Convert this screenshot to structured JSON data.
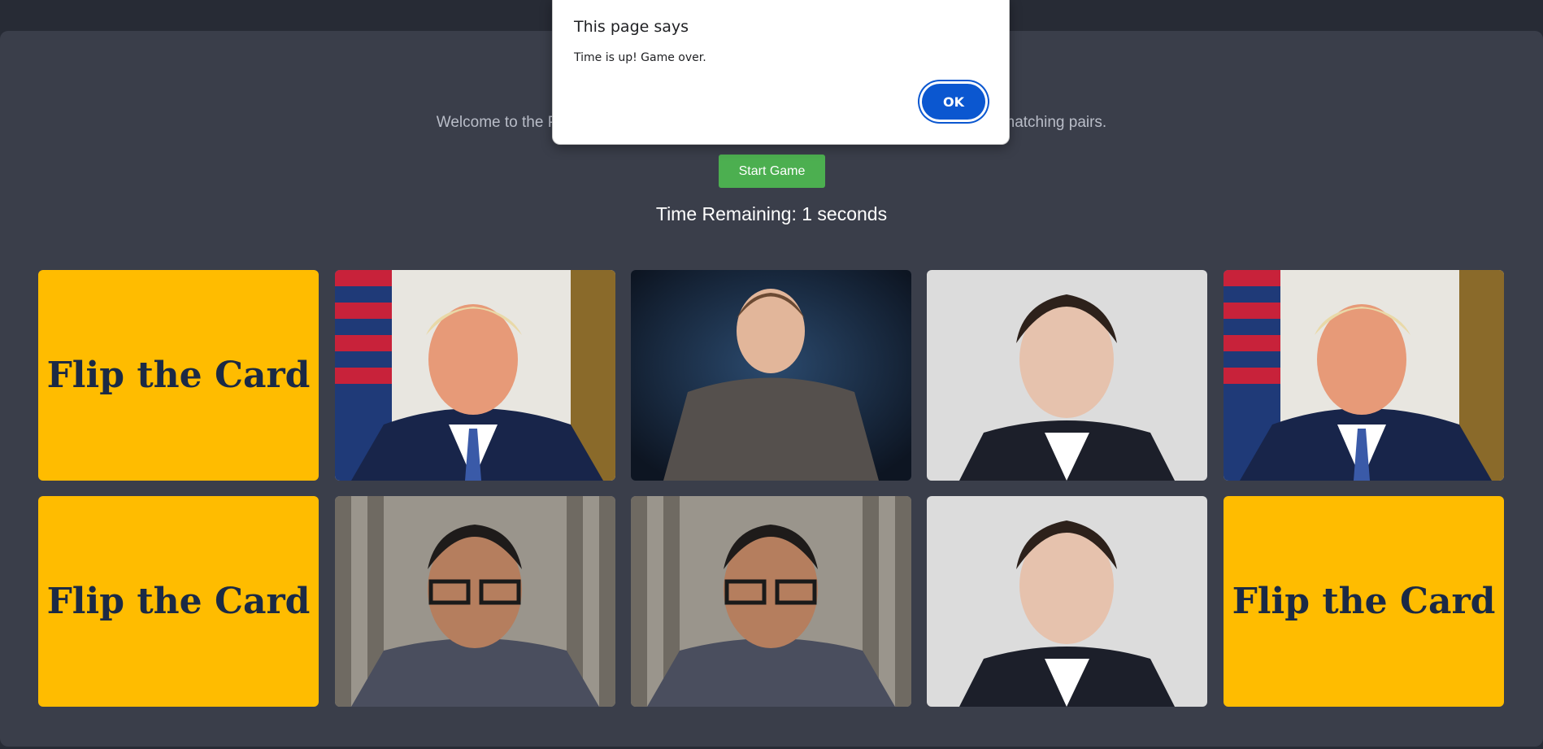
{
  "game": {
    "welcome_text": "Welcome to the Photo Matching Game! Click on the cards to flip them and find the matching pairs.",
    "start_label": "Start Game",
    "timer_text": "Time Remaining: 1 seconds"
  },
  "cards": [
    {
      "state": "back",
      "label": "Flip the Card"
    },
    {
      "state": "face",
      "subject": "man-suit-flag-photo"
    },
    {
      "state": "face",
      "subject": "man-gray-tshirt-photo"
    },
    {
      "state": "face",
      "subject": "man-dark-blazer-photo"
    },
    {
      "state": "face",
      "subject": "man-suit-flag-photo"
    },
    {
      "state": "back",
      "label": "Flip the Card"
    },
    {
      "state": "face",
      "subject": "man-glasses-blazer-photo"
    },
    {
      "state": "face",
      "subject": "man-glasses-blazer-photo"
    },
    {
      "state": "face",
      "subject": "man-dark-blazer-photo"
    },
    {
      "state": "back",
      "label": "Flip the Card"
    }
  ],
  "dialog": {
    "title": "This page says",
    "message": "Time is up! Game over.",
    "ok_label": "OK"
  },
  "colors": {
    "page_bg": "#272b35",
    "panel_bg": "#3a3e4a",
    "card_back": "#ffbc00",
    "card_text": "#1b2a45",
    "start_button": "#4caf50",
    "ok_button": "#0b57d0"
  }
}
